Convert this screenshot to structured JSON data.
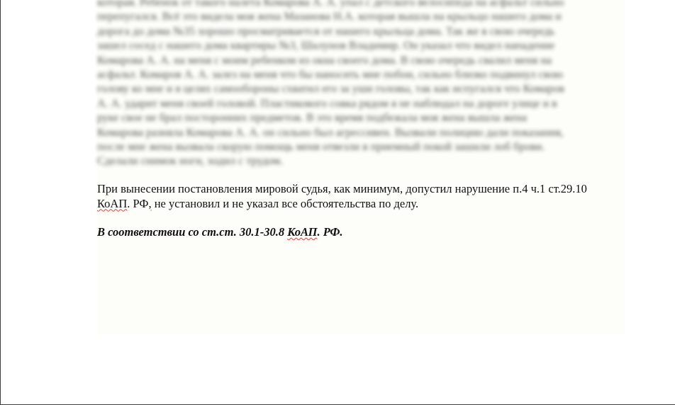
{
  "document": {
    "blurred_lines": [
      "которая. Ребенок от такого налета Комарова А. А. упал с детского велосипеда на асфальт сильно",
      "перепугался. Всё это видела моя жена Мазанова Н.А. которая вышла на крыльцо нашего дома и",
      "дорога до дома №35 хорошо просматривается от нашего крыльца дома. Так же в свою очередь",
      "зашел сосед с нашего дома квартиры №3, Шалунов Владимир. Он указал что видел нападение",
      "Комарова А. А. на меня с моим ребенком из окна своего дома. В свою очередь свалил меня на",
      "асфальт. Комаров А. А. залез на меня что бы наносить мне побои, сильно близко подвинул свою",
      "голову ко мне и я целях самообороны схватил его за уши головы, так как испугался что Комаров",
      "А. А. ударит меня своей головой. Пластикового совка рядом я не наблюдал на дороге улице и в",
      "руке свое не брал посторонних предметов. В это время подбежала моя жена вышла жена",
      "Комарова разняла Комарова А. А. он сильно был агрессивен. Вызвали полицию дали показания,",
      "после мне жена вызвала скорую помощь меня отвезли в приемный покой зашили лоб брови.",
      "Сделали снимок ноги, ходил с трудом."
    ],
    "paragraph1": {
      "line1": "При вынесении постановления мировой судья, как минимум, допустил нарушение п.4 ч.1 ст.29.10",
      "line2_word1": "КоАП",
      "line2_word2": ". РФ",
      "line2_word3": ",",
      "line2_rest": " не установил и не указал все обстоятельства по делу."
    },
    "paragraph2": {
      "part1": "В соответствии со ст.ст. 30.1-30.8 ",
      "part2": "КоАП",
      "part3": ". РФ."
    }
  }
}
